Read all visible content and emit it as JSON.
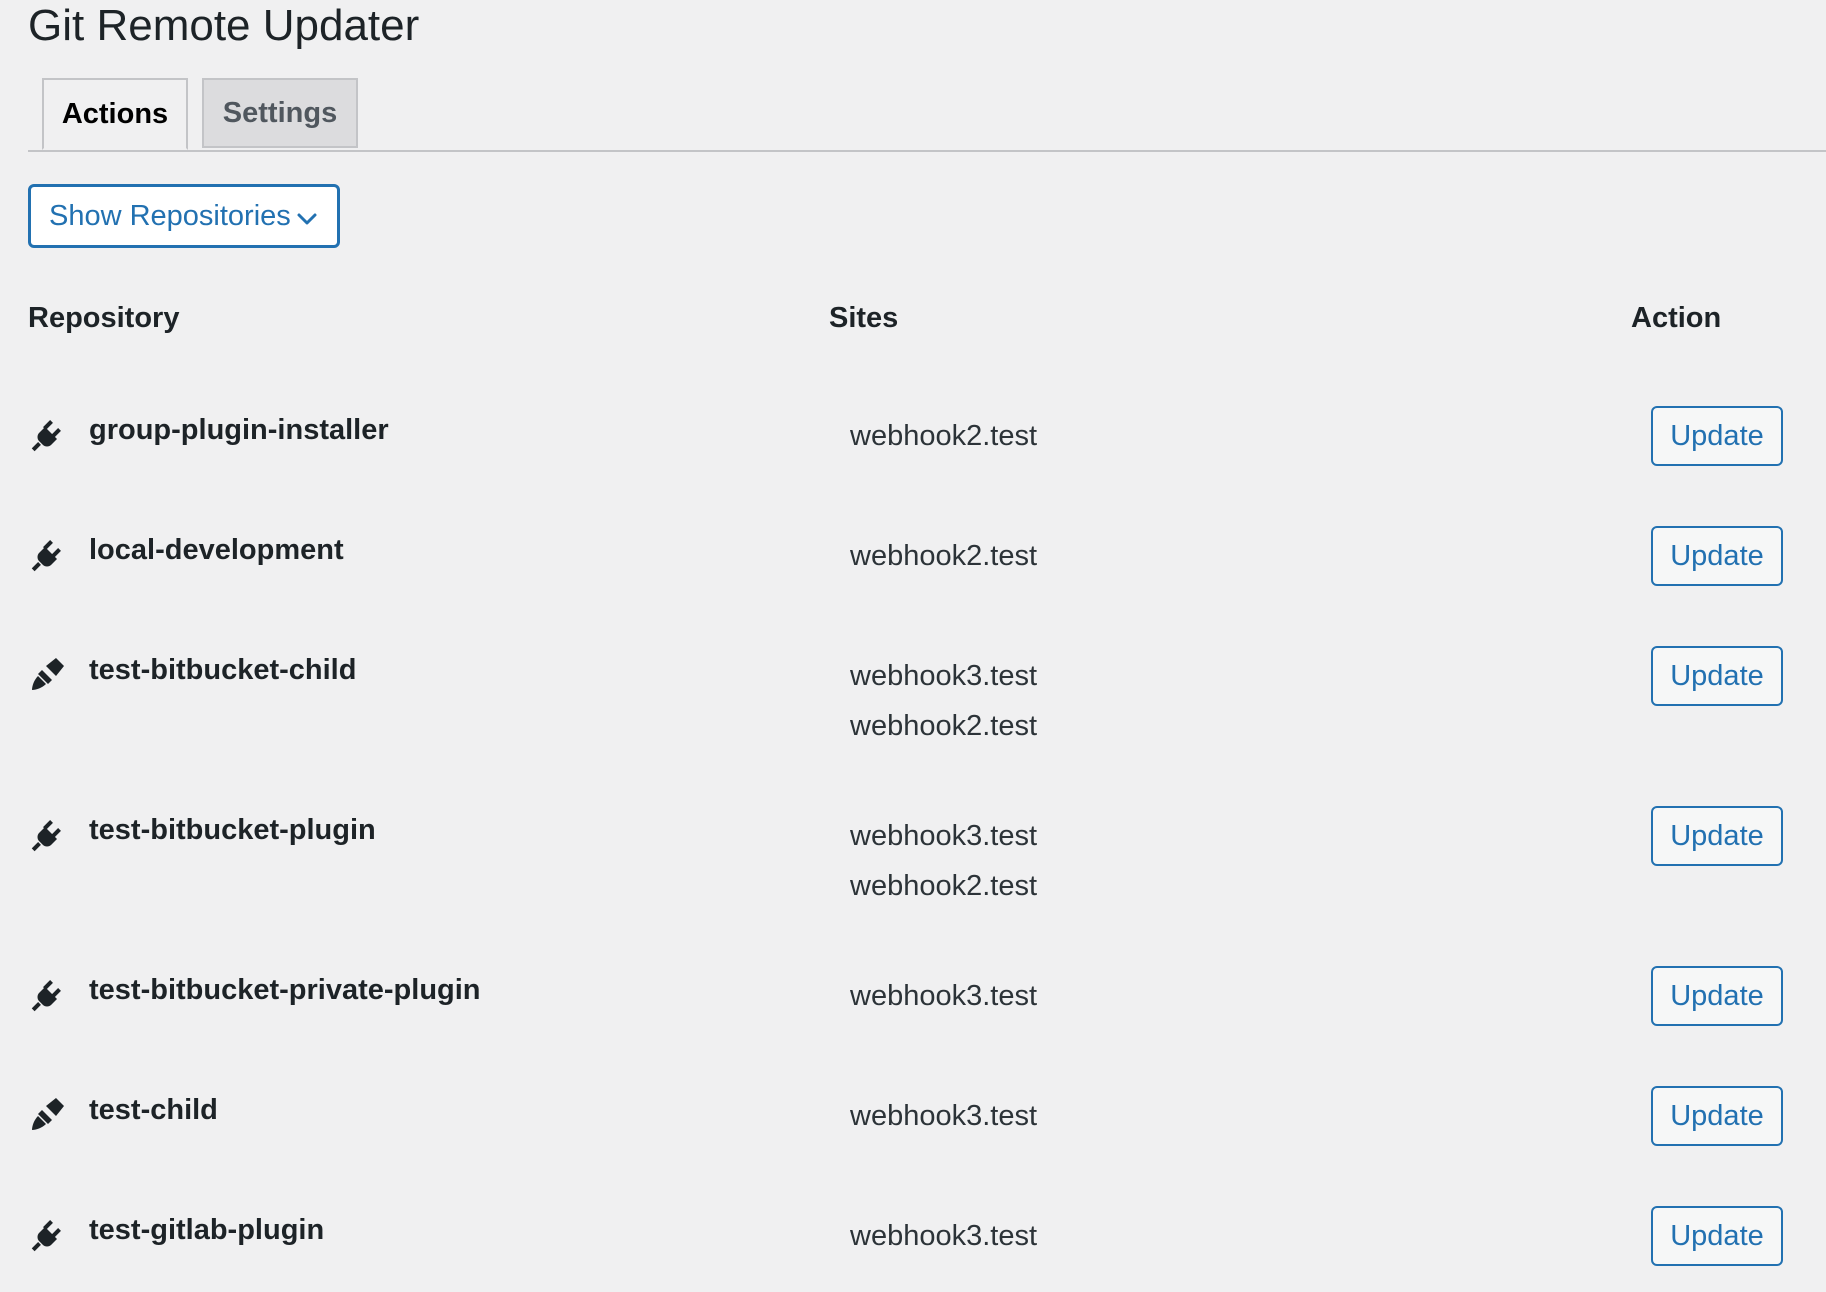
{
  "page": {
    "title": "Git Remote Updater"
  },
  "tabs": [
    {
      "label": "Actions",
      "active": true
    },
    {
      "label": "Settings",
      "active": false
    }
  ],
  "dropdown": {
    "label": "Show Repositories",
    "icon": "chevron-down-icon"
  },
  "table": {
    "headers": {
      "repository": "Repository",
      "sites": "Sites",
      "action": "Action"
    },
    "rows": [
      {
        "icon": "plugin-icon",
        "name": "group-plugin-installer",
        "sites": [
          "webhook2.test"
        ],
        "action": "Update"
      },
      {
        "icon": "plugin-icon",
        "name": "local-development",
        "sites": [
          "webhook2.test"
        ],
        "action": "Update"
      },
      {
        "icon": "theme-brush-icon",
        "name": "test-bitbucket-child",
        "sites": [
          "webhook3.test",
          "webhook2.test"
        ],
        "action": "Update"
      },
      {
        "icon": "plugin-icon",
        "name": "test-bitbucket-plugin",
        "sites": [
          "webhook3.test",
          "webhook2.test"
        ],
        "action": "Update"
      },
      {
        "icon": "plugin-icon",
        "name": "test-bitbucket-private-plugin",
        "sites": [
          "webhook3.test"
        ],
        "action": "Update"
      },
      {
        "icon": "theme-brush-icon",
        "name": "test-child",
        "sites": [
          "webhook3.test"
        ],
        "action": "Update"
      },
      {
        "icon": "plugin-icon",
        "name": "test-gitlab-plugin",
        "sites": [
          "webhook3.test"
        ],
        "action": "Update"
      }
    ]
  },
  "colors": {
    "accent": "#2271b1",
    "background": "#f0f0f1",
    "text": "#1d2327"
  }
}
